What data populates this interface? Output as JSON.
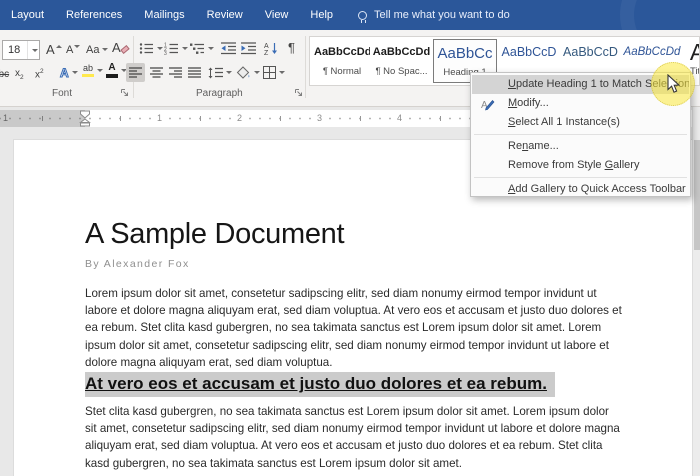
{
  "menubar": {
    "tabs": [
      "Layout",
      "References",
      "Mailings",
      "Review",
      "View",
      "Help"
    ],
    "tellme": "Tell me what you want to do"
  },
  "ribbon": {
    "font_group": {
      "label": "Font",
      "font_size": "18",
      "grow_font": "A",
      "shrink_font": "A",
      "change_case": "Aa",
      "strikethrough": "abc",
      "subscript_base": "x",
      "subscript_mark": "2",
      "superscript_base": "x",
      "superscript_mark": "2",
      "text_effects": "A",
      "highlight": "ab",
      "font_color": "A"
    },
    "paragraph_group": {
      "label": "Paragraph",
      "pilcrow": "¶",
      "sort_letters": "AZ"
    },
    "styles_gallery": {
      "items": [
        {
          "preview": "AaBbCcDd",
          "label": "¶ Normal",
          "style": "normal",
          "selected": false
        },
        {
          "preview": "AaBbCcDd",
          "label": "¶ No Spac...",
          "style": "normal",
          "selected": false
        },
        {
          "preview": "AaBbCc",
          "label": "Heading 1",
          "style": "h1",
          "selected": true
        },
        {
          "preview": "AaBbCcD",
          "label": "",
          "style": "h2",
          "selected": false
        },
        {
          "preview": "AaBbCcD",
          "label": "",
          "style": "h3",
          "selected": false
        },
        {
          "preview": "AaBbCcDd",
          "label": "",
          "style": "h4",
          "selected": false
        },
        {
          "preview": "Aa",
          "label": "Title",
          "style": "title",
          "selected": false
        }
      ]
    }
  },
  "ruler": {
    "numbers": [
      "1",
      "1",
      "2",
      "3",
      "4"
    ]
  },
  "context_menu": {
    "items": [
      {
        "label": "Update Heading 1 to Match Selection",
        "underline": 0,
        "highlighted": true,
        "icon": "",
        "separator_after": false
      },
      {
        "label": "Modify...",
        "underline": 0,
        "highlighted": false,
        "icon": "modify-style-icon",
        "separator_after": false
      },
      {
        "label": "Select All 1 Instance(s)",
        "underline": 0,
        "highlighted": false,
        "icon": "",
        "separator_after": true
      },
      {
        "label": "Rename...",
        "underline": 2,
        "highlighted": false,
        "icon": "",
        "separator_after": false
      },
      {
        "label": "Remove from Style Gallery",
        "underline": 18,
        "highlighted": false,
        "icon": "",
        "separator_after": true
      },
      {
        "label": "Add Gallery to Quick Access Toolbar",
        "underline": 0,
        "highlighted": false,
        "icon": "",
        "separator_after": false
      }
    ]
  },
  "document": {
    "title": "A Sample Document",
    "byline": "By Alexander Fox",
    "paragraph1": "Lorem ipsum dolor sit amet, consetetur sadipscing elitr, sed diam nonumy eirmod tempor invidunt ut labore et dolore magna aliquyam erat, sed diam voluptua. At vero eos et accusam et justo duo dolores et ea rebum. Stet clita kasd gubergren, no sea takimata sanctus est Lorem ipsum dolor sit amet. Lorem ipsum dolor sit amet, consetetur sadipscing elitr,  sed diam nonumy eirmod tempor invidunt ut labore et dolore magna aliquyam erat, sed diam voluptua.",
    "heading": "At vero eos et accusam et justo duo dolores et ea rebum.",
    "paragraph2": "Stet clita kasd gubergren, no sea takimata sanctus est Lorem ipsum dolor sit amet. Lorem ipsum dolor sit amet, consetetur sadipscing elitr,  sed diam nonumy eirmod tempor invidunt ut labore et dolore magna aliquyam erat, sed diam voluptua. At vero eos et accusam et justo duo dolores et ea rebum. Stet clita kasd gubergren, no sea takimata sanctus est Lorem ipsum dolor sit amet."
  },
  "colors": {
    "titlebar_blue": "#2b579a",
    "heading_preview_blue": "#2f5496",
    "selection_gray": "#cbcbcb",
    "menu_highlight": "#d4d4d4",
    "click_halo_yellow": "#fce93d"
  }
}
